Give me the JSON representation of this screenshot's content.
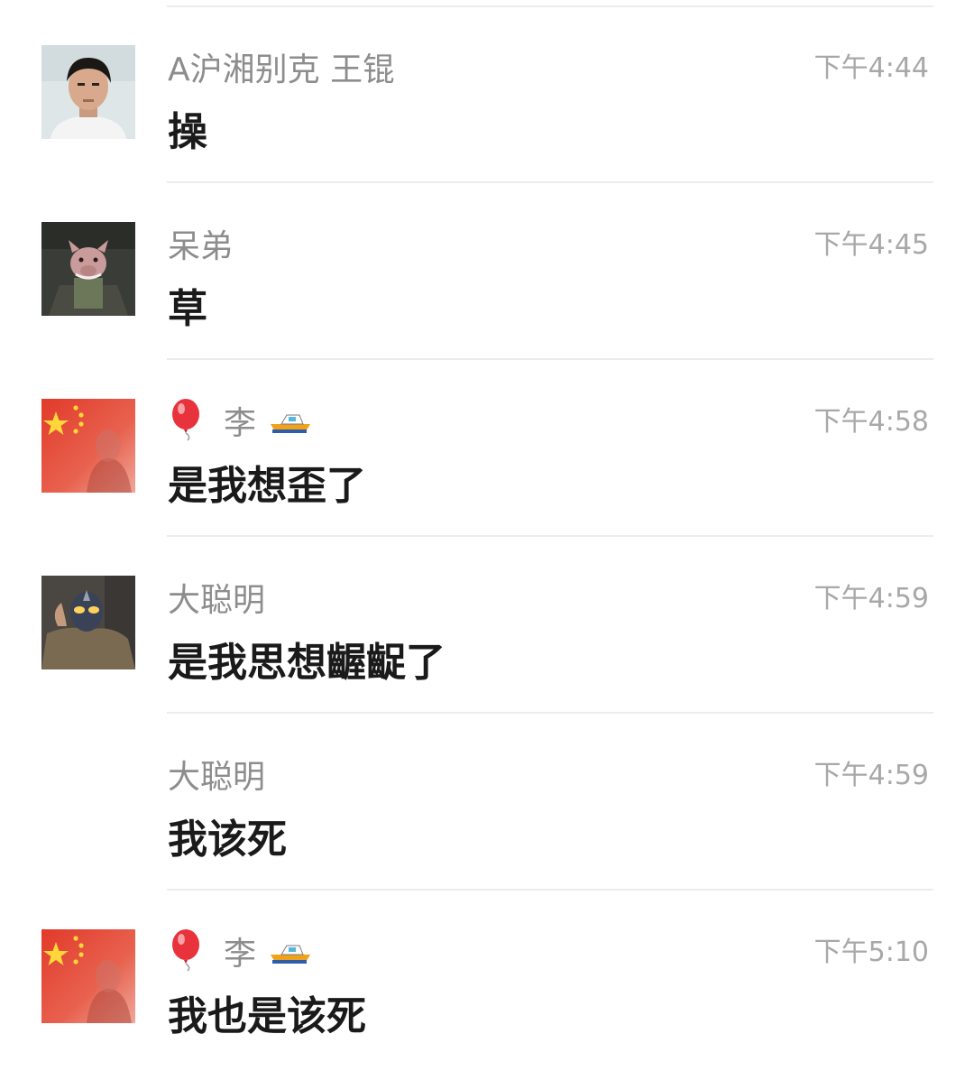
{
  "messages": [
    {
      "sender": "A沪湘别克 王锟",
      "text": "操",
      "time": "下午4:44",
      "avatar": "young-man-photo-avatar"
    },
    {
      "sender": "呆弟",
      "text": "草",
      "time": "下午4:45",
      "avatar": "cartoon-pig-avatar"
    },
    {
      "sender": "李",
      "text": "是我想歪了",
      "time": "下午4:58",
      "avatar": "flag-avatar",
      "emoji_left": "balloon-icon",
      "emoji_right": "speedboat-icon"
    },
    {
      "sender": "大聪明",
      "text": "是我思想齷齪了",
      "time": "下午4:59",
      "avatar": "masked-hero-avatar"
    },
    {
      "sender": "大聪明",
      "text": "我该死",
      "time": "下午4:59",
      "avatar": ""
    },
    {
      "sender": "李",
      "text": "我也是该死",
      "time": "下午5:10",
      "avatar": "flag-avatar",
      "emoji_left": "balloon-icon",
      "emoji_right": "speedboat-icon"
    }
  ],
  "colors": {
    "sender": "#8d8d8d",
    "time": "#a8a8a8",
    "text": "#1a1a1a",
    "divider": "#ececec",
    "flag_red": "#e23a2a",
    "flag_star": "#ffd73a"
  }
}
